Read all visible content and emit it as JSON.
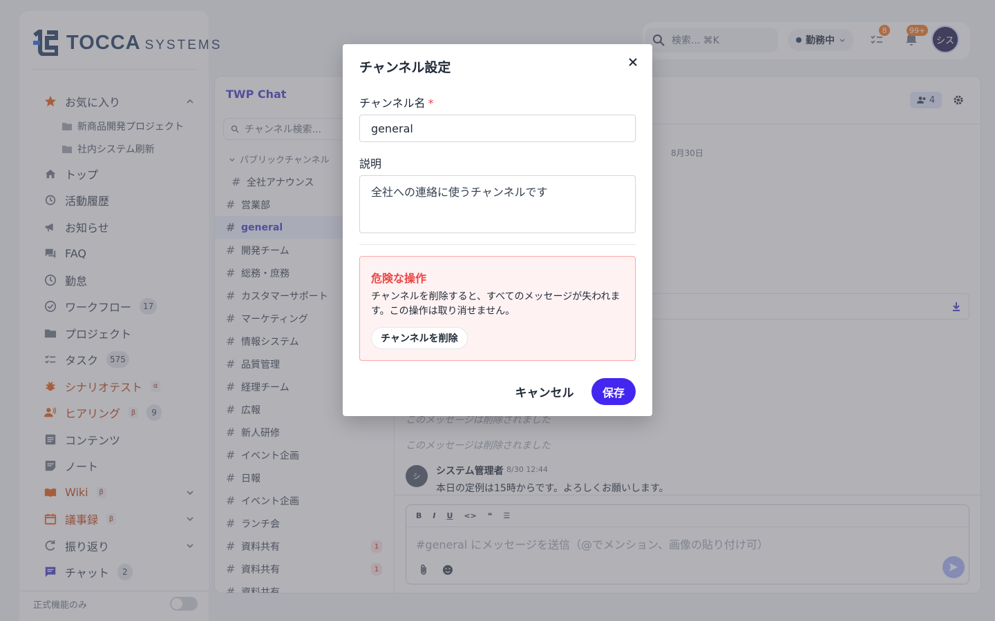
{
  "app": {
    "logo_main": "TOCCA",
    "logo_sub": "SYSTEMS"
  },
  "colors": {
    "brand": "#1e3a5f",
    "accent": "#4326f0",
    "danger": "#ef4444",
    "orange": "#c2410c"
  },
  "sidebar": {
    "favorites": {
      "label": "お気に入り",
      "icon": "star-icon"
    },
    "favorite_items": [
      {
        "label": "新商品開発プロジェクト",
        "icon": "folder-icon"
      },
      {
        "label": "社内システム刷新",
        "icon": "folder-icon"
      }
    ],
    "items": [
      {
        "label": "トップ",
        "icon": "home-icon"
      },
      {
        "label": "活動履歴",
        "icon": "history-icon"
      },
      {
        "label": "お知らせ",
        "icon": "megaphone-icon"
      },
      {
        "label": "FAQ",
        "icon": "forum-icon"
      },
      {
        "label": "勤怠",
        "icon": "clock-icon"
      },
      {
        "label": "ワークフロー",
        "icon": "check-circle-icon",
        "badge": "17"
      },
      {
        "label": "プロジェクト",
        "icon": "folder-icon"
      },
      {
        "label": "タスク",
        "icon": "checklist-icon",
        "badge": "575"
      },
      {
        "label": "シナリオテスト",
        "icon": "bug-icon",
        "tag": "α"
      },
      {
        "label": "ヒアリング",
        "icon": "people-icon",
        "tag": "β",
        "badge": "9"
      },
      {
        "label": "コンテンツ",
        "icon": "article-icon"
      },
      {
        "label": "ノート",
        "icon": "note-icon"
      },
      {
        "label": "Wiki",
        "icon": "book-icon",
        "tag": "β"
      },
      {
        "label": "議事録",
        "icon": "calendar-icon",
        "tag": "β"
      },
      {
        "label": "振り返り",
        "icon": "refresh-icon"
      },
      {
        "label": "チャット",
        "icon": "chat-icon",
        "badge": "2"
      }
    ],
    "footer_label": "正式機能のみ"
  },
  "topbar": {
    "search_placeholder": "検索... ⌘K",
    "status": "勤務中",
    "tasks_badge": "8",
    "notifications_badge": "99+",
    "avatar": "シス"
  },
  "chat": {
    "title": "TWP Chat",
    "search_placeholder": "チャンネル検索...",
    "group_label": "パブリックチャンネル",
    "channels": [
      {
        "name": "全社アナウンス"
      },
      {
        "name": "営業部"
      },
      {
        "name": "general",
        "active": true
      },
      {
        "name": "開発チーム"
      },
      {
        "name": "総務・庶務"
      },
      {
        "name": "カスタマーサポート"
      },
      {
        "name": "マーケティング"
      },
      {
        "name": "情報システム"
      },
      {
        "name": "品質管理"
      },
      {
        "name": "経理チーム"
      },
      {
        "name": "広報"
      },
      {
        "name": "新人研修"
      },
      {
        "name": "イベント企画"
      },
      {
        "name": "日報"
      },
      {
        "name": "イベント企画"
      },
      {
        "name": "ランチ会"
      },
      {
        "name": "資料共有",
        "unread": "1"
      },
      {
        "name": "資料共有",
        "unread": "1"
      },
      {
        "name": "資料共有"
      }
    ],
    "members_count": "4",
    "date_divider": "8月30日",
    "deleted_message": "このメッセージは削除されました",
    "message": {
      "author": "システム管理者",
      "avatar": "シ",
      "time": "8/30 12:44",
      "text": "本日の定例は15時からです。よろしくお願いします。"
    },
    "composer": {
      "toolbar": [
        "B",
        "I",
        "U",
        "<>",
        "❝",
        "☰"
      ],
      "placeholder": "#general にメッセージを送信（@でメンション、画像の貼り付け可）"
    }
  },
  "modal": {
    "title": "チャンネル設定",
    "name_label": "チャンネル名",
    "required_mark": "*",
    "name_value": "general",
    "desc_label": "説明",
    "desc_value": "全社への連絡に使うチャンネルです",
    "danger_title": "危険な操作",
    "danger_text": "チャンネルを削除すると、すべてのメッセージが失われます。この操作は取り消せません。",
    "delete_button": "チャンネルを削除",
    "cancel_button": "キャンセル",
    "save_button": "保存"
  }
}
